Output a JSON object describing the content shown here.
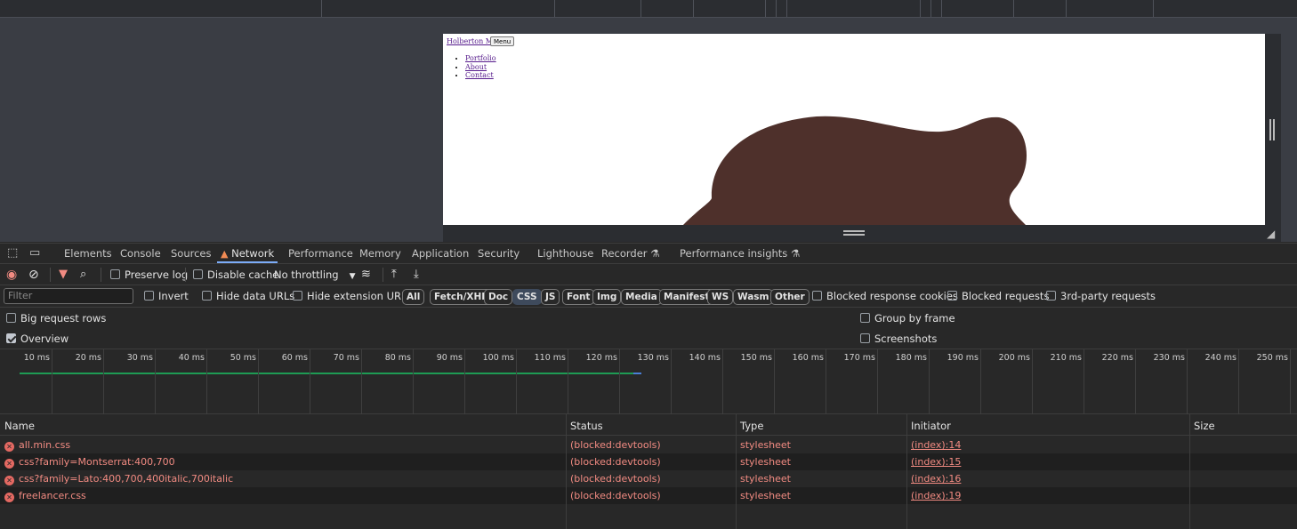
{
  "viewport": {
    "brand_link": "Holberton Me",
    "menu_button": "Menu",
    "nav_links": [
      "Portfolio",
      "About",
      "Contact"
    ],
    "blob_color": "#4e302b"
  },
  "devtools": {
    "tabs": [
      "Elements",
      "Console",
      "Sources",
      "Network",
      "Performance",
      "Memory",
      "Application",
      "Security",
      "Lighthouse",
      "Recorder",
      "Performance insights"
    ],
    "active_tab": "Network",
    "toolbar": {
      "preserve_log": "Preserve log",
      "disable_cache": "Disable cache",
      "throttling": "No throttling"
    },
    "filter": {
      "placeholder": "Filter",
      "invert": "Invert",
      "hide_data_urls": "Hide data URLs",
      "hide_extension_urls": "Hide extension URLs",
      "type_chips": [
        "All",
        "Fetch/XHR",
        "Doc",
        "CSS",
        "JS",
        "Font",
        "Img",
        "Media",
        "Manifest",
        "WS",
        "Wasm",
        "Other"
      ],
      "selected_chip": "CSS",
      "blocked_response_cookies": "Blocked response cookies",
      "blocked_requests": "Blocked requests",
      "third_party_requests": "3rd-party requests"
    },
    "options": {
      "big_request_rows": "Big request rows",
      "overview": "Overview",
      "group_by_frame": "Group by frame",
      "screenshots": "Screenshots"
    },
    "timeline_ticks": [
      "10 ms",
      "20 ms",
      "30 ms",
      "40 ms",
      "50 ms",
      "60 ms",
      "70 ms",
      "80 ms",
      "90 ms",
      "100 ms",
      "110 ms",
      "120 ms",
      "130 ms",
      "140 ms",
      "150 ms",
      "160 ms",
      "170 ms",
      "180 ms",
      "190 ms",
      "200 ms",
      "210 ms",
      "220 ms",
      "230 ms",
      "240 ms",
      "250 ms"
    ],
    "table": {
      "headers": {
        "name": "Name",
        "status": "Status",
        "type": "Type",
        "initiator": "Initiator",
        "size": "Size"
      },
      "rows": [
        {
          "name": "all.min.css",
          "status": "(blocked:devtools)",
          "type": "stylesheet",
          "initiator": "(index):14"
        },
        {
          "name": "css?family=Montserrat:400,700",
          "status": "(blocked:devtools)",
          "type": "stylesheet",
          "initiator": "(index):15"
        },
        {
          "name": "css?family=Lato:400,700,400italic,700italic",
          "status": "(blocked:devtools)",
          "type": "stylesheet",
          "initiator": "(index):16"
        },
        {
          "name": "freelancer.css",
          "status": "(blocked:devtools)",
          "type": "stylesheet",
          "initiator": "(index):19"
        }
      ]
    }
  }
}
